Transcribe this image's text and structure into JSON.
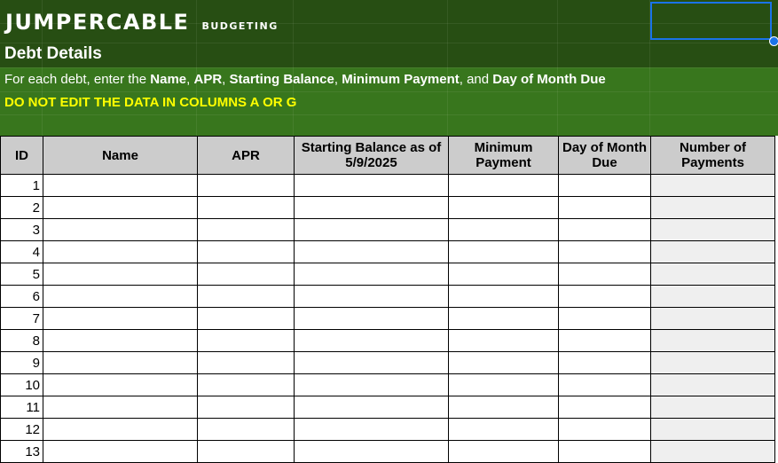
{
  "header": {
    "brand": "Jumpercable",
    "subtitle": "Budgeting",
    "section_title": "Debt Details",
    "instructions": {
      "prefix": "For each debt, enter the ",
      "name": "Name",
      "sep1": ", ",
      "apr": "APR",
      "sep2": ", ",
      "balance": "Starting Balance",
      "sep3": ", ",
      "min_payment": "Minimum Payment",
      "sep4": ", and ",
      "due_day": "Day of Month Due"
    },
    "warning": "DO NOT EDIT THE DATA IN COLUMNS A OR G"
  },
  "colors": {
    "banner_dark": "#274e13",
    "banner_light": "#38761d",
    "warning_text": "#ffff00",
    "header_fill": "#cccccc",
    "payments_fill": "#efefef",
    "selection": "#1a73e8"
  },
  "table": {
    "columns": [
      "ID",
      "Name",
      "APR",
      "Starting Balance as of 5/9/2025",
      "Minimum Payment",
      "Day of Month Due",
      "Number of Payments"
    ],
    "rows": [
      {
        "id": "1"
      },
      {
        "id": "2"
      },
      {
        "id": "3"
      },
      {
        "id": "4"
      },
      {
        "id": "5"
      },
      {
        "id": "6"
      },
      {
        "id": "7"
      },
      {
        "id": "8"
      },
      {
        "id": "9"
      },
      {
        "id": "10"
      },
      {
        "id": "11"
      },
      {
        "id": "12"
      },
      {
        "id": "13"
      }
    ]
  }
}
